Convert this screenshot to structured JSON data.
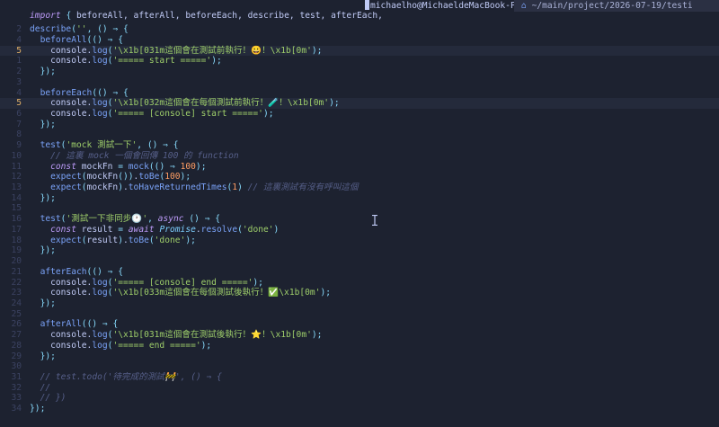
{
  "header": {
    "import_line": "import { beforeAll, afterAll, beforeEach, describe, test, afterEach,",
    "user_host": "michaelho@MichaeldeMacBook-Pro",
    "path": "~/main/project/2026-07-19/testi"
  },
  "lines": [
    {
      "n": "",
      "text": ""
    },
    {
      "n": "",
      "text": "describe('', () ⇒ {"
    },
    {
      "n": "4",
      "text": "  beforeAll(() ⇒ {"
    },
    {
      "n": "5",
      "text": "    console.log('\\x1b[031m這個會在測試前執行！😀！\\x1b[0m');"
    },
    {
      "n": "",
      "text": "    console.log('===== start =====');"
    },
    {
      "n": "",
      "text": "  });"
    },
    {
      "n": "",
      "text": ""
    },
    {
      "n": "4",
      "text": "  beforeEach(() ⇒ {"
    },
    {
      "n": "",
      "text": "    console.log('\\x1b[032m這個會在每個測試前執行！🧪！\\x1b[0m');"
    },
    {
      "n": "",
      "text": "    console.log('===== [console] start =====');"
    },
    {
      "n": "",
      "text": "  });"
    },
    {
      "n": "",
      "text": ""
    },
    {
      "n": "",
      "text": "  test('mock 測試一下', () ⇒ {"
    },
    {
      "n": "",
      "text": "    // 這裏 mock 一個會回傳 100 的 function"
    },
    {
      "n": "",
      "text": "    const mockFn = mock(() ⇒ 100);"
    },
    {
      "n": "",
      "text": "    expect(mockFn()).toBe(100);"
    },
    {
      "n": "",
      "text": "    expect(mockFn).toHaveReturnedTimes(1) // 這裏測試有沒有呼叫這個"
    },
    {
      "n": "",
      "text": "  });"
    },
    {
      "n": "",
      "text": ""
    },
    {
      "n": "",
      "text": "  test('測試一下非同步🕐', async () ⇒ {"
    },
    {
      "n": "",
      "text": "    const result = await Promise.resolve('done')"
    },
    {
      "n": "",
      "text": "    expect(result).toBe('done');"
    },
    {
      "n": "",
      "text": "  });"
    },
    {
      "n": "",
      "text": ""
    },
    {
      "n": "",
      "text": "  afterEach(() ⇒ {"
    },
    {
      "n": "",
      "text": "    console.log('===== [console] end =====');"
    },
    {
      "n": "",
      "text": "    console.log('\\x1b[033m這個會在每個測試後執行！✅\\x1b[0m');"
    },
    {
      "n": "",
      "text": "  });"
    },
    {
      "n": "",
      "text": ""
    },
    {
      "n": "",
      "text": "  afterAll(() ⇒ {"
    },
    {
      "n": "",
      "text": "    console.log('\\x1b[031m這個會在測試後執行！⭐！\\x1b[0m');"
    },
    {
      "n": "",
      "text": "    console.log('===== end =====');"
    },
    {
      "n": "",
      "text": "  });"
    },
    {
      "n": "",
      "text": ""
    },
    {
      "n": "",
      "text": "  // test.todo('待完成的測試🚧', () ⇒ {"
    },
    {
      "n": "",
      "text": "  //"
    },
    {
      "n": "",
      "text": "  // })"
    },
    {
      "n": "",
      "text": "});"
    }
  ],
  "gutter": [
    "",
    "2",
    "4",
    "5",
    "1",
    "2",
    "3",
    "4",
    "5",
    "6",
    "7",
    "8",
    "9",
    "10",
    "11",
    "12",
    "13",
    "14",
    "15",
    "16",
    "17",
    "18",
    "19",
    "20",
    "21",
    "22",
    "23",
    "24",
    "25",
    "26",
    "27",
    "28",
    "29",
    "30",
    "31",
    "32",
    "33",
    "34"
  ],
  "current_line": "5"
}
